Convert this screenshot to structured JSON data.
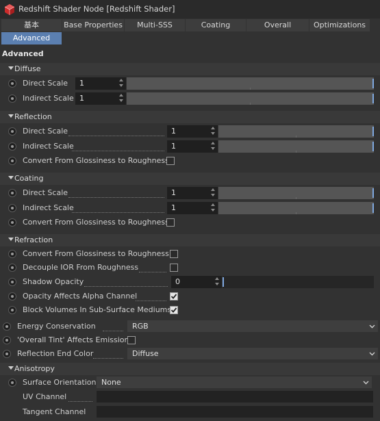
{
  "window": {
    "title": "Redshift Shader Node [Redshift Shader]",
    "app_icon": "redshift-cube-icon",
    "accent": "#5b7fb0",
    "icon_red": "#cc2a2a"
  },
  "tabs": [
    "基本",
    "Base Properties",
    "Multi-SSS",
    "Coating",
    "Overall",
    "Optimizations",
    "Advanced"
  ],
  "section_title": "Advanced",
  "diffuse": {
    "header": "Diffuse",
    "direct_label": "Direct Scale",
    "direct_value": "1",
    "indirect_label": "Indirect Scale",
    "indirect_value": "1"
  },
  "reflection": {
    "header": "Reflection",
    "direct_label": "Direct Scale",
    "direct_value": "1",
    "indirect_label": "Indirect Scale",
    "indirect_value": "1",
    "convert_label": "Convert From Glossiness to Roughness",
    "convert_checked": false
  },
  "coating": {
    "header": "Coating",
    "direct_label": "Direct Scale",
    "direct_value": "1",
    "indirect_label": "Indirect Scale",
    "indirect_value": "1",
    "convert_label": "Convert From Glossiness to Roughness",
    "convert_checked": false
  },
  "refraction": {
    "header": "Refraction",
    "convert_label": "Convert From Glossiness to Roughness",
    "convert_checked": false,
    "decouple_label": "Decouple IOR From Roughness",
    "decouple_checked": false,
    "shadow_label": "Shadow Opacity",
    "shadow_value": "0",
    "opacity_alpha_label": "Opacity Affects Alpha Channel",
    "opacity_alpha_checked": true,
    "block_volumes_label": "Block Volumes In Sub-Surface Mediums",
    "block_volumes_checked": true
  },
  "general": {
    "energy_label": "Energy Conservation",
    "energy_value": "RGB",
    "overall_tint_label": "'Overall Tint' Affects Emission",
    "overall_tint_checked": false,
    "reflection_end_label": "Reflection End Color",
    "reflection_end_value": "Diffuse"
  },
  "anisotropy": {
    "header": "Anisotropy",
    "surface_label": "Surface Orientation",
    "surface_value": "None",
    "uv_label": "UV Channel",
    "uv_value": "",
    "tangent_label": "Tangent Channel",
    "tangent_value": ""
  }
}
